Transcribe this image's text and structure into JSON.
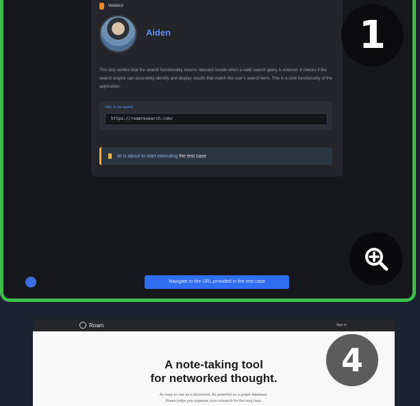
{
  "step1": {
    "tag_text": "Webtest",
    "agent_name": "Aiden",
    "description": "This test verifies that the search functionality returns relevant results when a valid search query is entered. It checks if the search engine can accurately identify and display results that match the user's search term. This is a core functionality of the application.",
    "url_label": "URL to be tested",
    "url_value": "https://roamresearch.com/",
    "status_prefix": "AI is about to start executing",
    "status_suffix": "the test case",
    "badge_number": "1",
    "action_caption": "Navigate to the URL provided in the test case"
  },
  "step4": {
    "logo_text": "Roam",
    "signin_text": "Sign in",
    "headline_line1": "A note-taking tool",
    "headline_line2": "for networked thought.",
    "sub_line1": "As easy to use as a document. As powerful as a graph database.",
    "sub_line2": "Roam helps you organize your research for the long haul.",
    "badge_number": "4"
  },
  "icons": {
    "zoom": "zoom-in-icon",
    "tag": "webtest-icon",
    "status": "info-icon"
  },
  "colors": {
    "frame_border": "#3ebd4b",
    "accent_blue": "#2f6df1",
    "status_accent": "#e7b44a"
  }
}
